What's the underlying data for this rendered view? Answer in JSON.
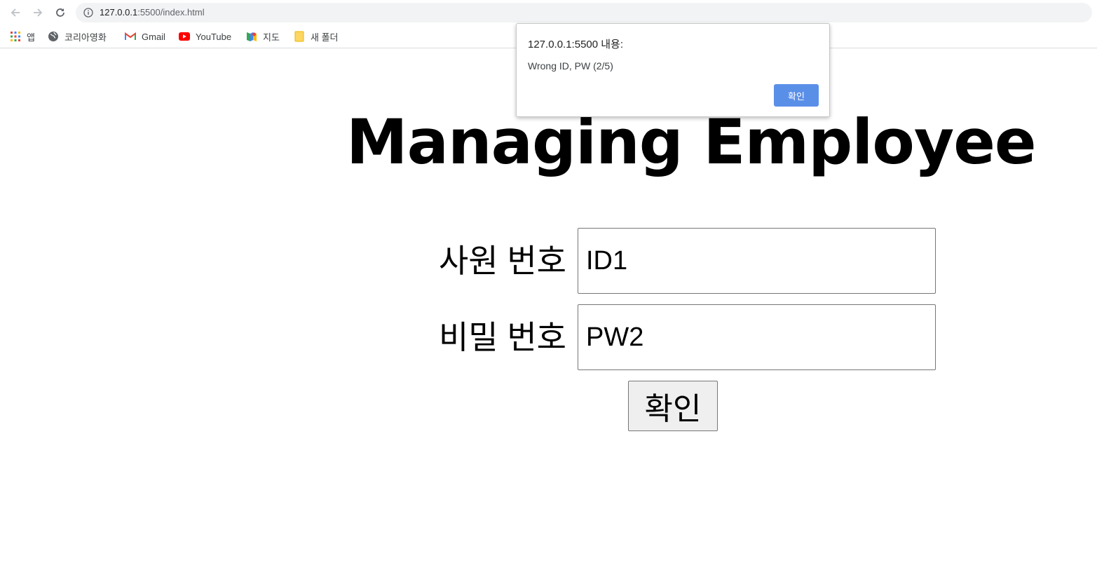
{
  "browser": {
    "url_host": "127.0.0.1",
    "url_path": ":5500/index.html",
    "bookmarks": [
      {
        "label": "앱",
        "icon": "apps-grid-icon"
      },
      {
        "label": "코리아영화",
        "icon": "globe-icon"
      },
      {
        "label": "Gmail",
        "icon": "gmail-icon"
      },
      {
        "label": "YouTube",
        "icon": "youtube-icon"
      },
      {
        "label": "지도",
        "icon": "maps-icon"
      },
      {
        "label": "새 폴더",
        "icon": "folder-icon"
      }
    ]
  },
  "page": {
    "title": "Managing Employee",
    "employee_id_label": "사원 번호",
    "employee_id_value": "ID1",
    "password_label": "비밀 번호",
    "password_value": "PW2",
    "confirm_label": "확인"
  },
  "dialog": {
    "title": "127.0.0.1:5500 내용:",
    "message": "Wrong ID, PW (2/5)",
    "ok_label": "확인",
    "ok_color": "#5a8fe8"
  }
}
